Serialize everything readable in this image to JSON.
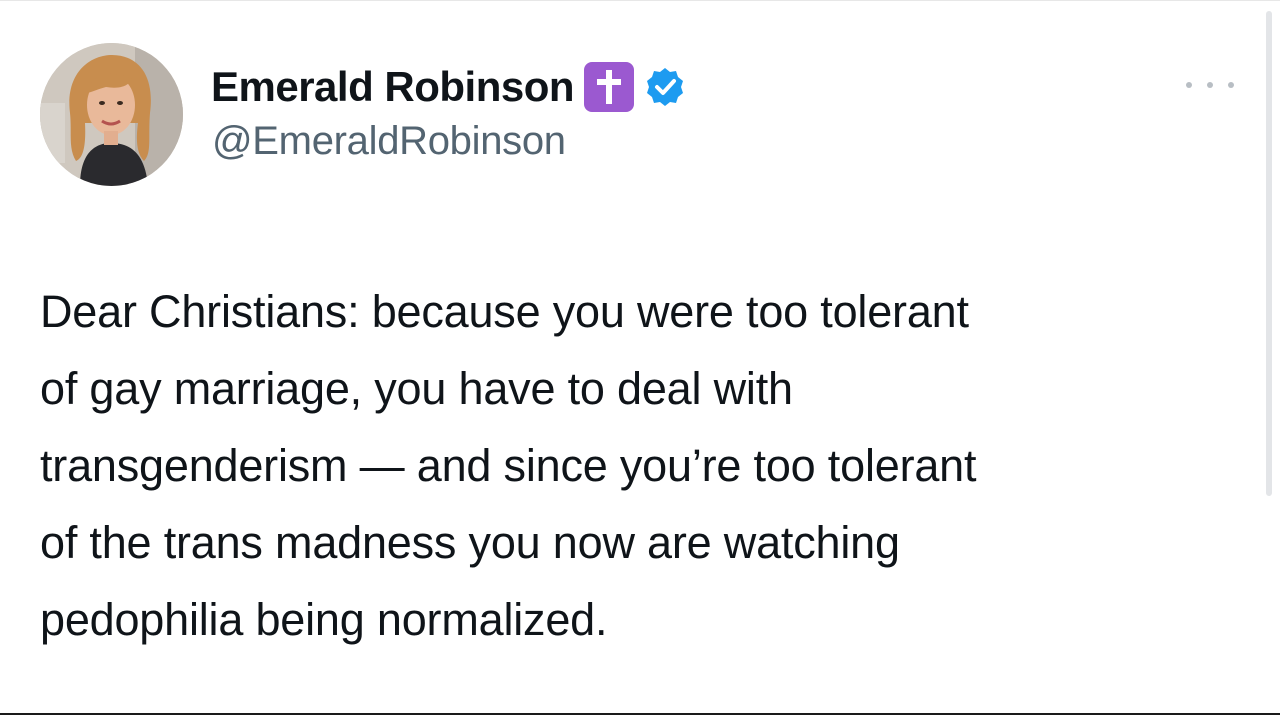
{
  "tweet": {
    "author": {
      "display_name": "Emerald Robinson",
      "handle": "@EmeraldRobinson",
      "badge_icon": "latin-cross-icon",
      "badge_color": "#9b59d0",
      "verified_icon": "verified-check-icon",
      "verified_color": "#1d9bf0"
    },
    "more_icon": "more-horizontal-icon",
    "text_lines": [
      "Dear Christians: because you were too tolerant",
      "of gay marriage, you have to deal with",
      "transgenderism — and since you’re too tolerant",
      "of the trans madness you now are watching",
      "pedophilia being normalized."
    ]
  },
  "colors": {
    "text_primary": "#0f1419",
    "text_secondary": "#536471",
    "background": "#ffffff"
  }
}
